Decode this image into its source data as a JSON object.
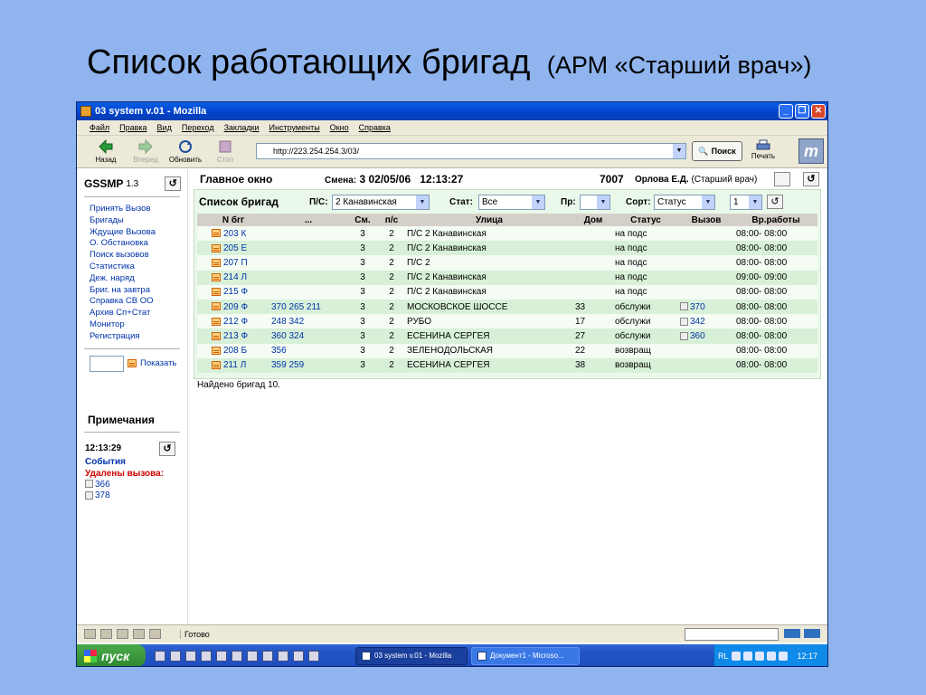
{
  "slide": {
    "title": "Список работающих бригад",
    "subtitle": "(АРМ «Старший врач»)"
  },
  "window": {
    "title": "03 system v.01 - Mozilla",
    "menu": [
      "Файл",
      "Правка",
      "Вид",
      "Переход",
      "Закладки",
      "Инструменты",
      "Окно",
      "Справка"
    ],
    "toolbar": {
      "back": "Назад",
      "forward": "Вперед",
      "reload": "Обновить",
      "stop": "Стоп",
      "url": "http://223.254.254.3/03/",
      "search": "Поиск",
      "print": "Печать"
    },
    "logo_letter": "m"
  },
  "sidebar": {
    "app_name": "GSSMP",
    "version": "1.3",
    "links": [
      "Принять Вызов",
      "Бригады",
      "Ждущие Вызова",
      "О. Обстановка",
      "Поиск вызовов",
      "Статистика",
      "Деж. наряд",
      "Бриг. на завтра",
      "Справка СВ ОО",
      "Архив Сп+Стат",
      "Монитор",
      "Регистрация"
    ],
    "show_label": "Показать",
    "notes_title": "Примечания",
    "notes_time": "12:13:29",
    "events_label": "События",
    "deleted_label": "Удалены вызова:",
    "deleted_calls": [
      "366",
      "378"
    ]
  },
  "main": {
    "title": "Главное окно",
    "shift_label": "Смена:",
    "shift_no": "3",
    "date": "02/05/06",
    "time": "12:13:27",
    "user_id": "7007",
    "user_name": "Орлова Е.Д.",
    "user_role": "(Старший врач)"
  },
  "brigades": {
    "title": "Список бригад",
    "ps_label": "П/С:",
    "ps_value": "2 Канавинская",
    "stat_label": "Стат:",
    "stat_value": "Все",
    "pr_label": "Пр:",
    "pr_value": "",
    "sort_label": "Сорт:",
    "sort_value": "Статус",
    "page_value": "1",
    "columns": [
      "N бrг",
      "...",
      "См.",
      "п/с",
      "Улица",
      "Дом",
      "Статус",
      "Вызов",
      "Вр.работы"
    ],
    "rows": [
      {
        "brig": "203 К",
        "calls": "",
        "shift": "3",
        "ps": "2",
        "street": "П/С 2 Канавинская",
        "house": "",
        "status": "на подс",
        "call": "",
        "hours": "08:00- 08:00"
      },
      {
        "brig": "205 Е",
        "calls": "",
        "shift": "3",
        "ps": "2",
        "street": "П/С 2 Канавинская",
        "house": "",
        "status": "на подс",
        "call": "",
        "hours": "08:00- 08:00"
      },
      {
        "brig": "207 П",
        "calls": "",
        "shift": "3",
        "ps": "2",
        "street": "П/С 2",
        "house": "",
        "status": "на подс",
        "call": "",
        "hours": "08:00- 08:00"
      },
      {
        "brig": "214 Л",
        "calls": "",
        "shift": "3",
        "ps": "2",
        "street": "П/С 2 Канавинская",
        "house": "",
        "status": "на подс",
        "call": "",
        "hours": "09:00- 09:00"
      },
      {
        "brig": "215 Ф",
        "calls": "",
        "shift": "3",
        "ps": "2",
        "street": "П/С 2 Канавинская",
        "house": "",
        "status": "на подс",
        "call": "",
        "hours": "08:00- 08:00"
      },
      {
        "brig": "209 Ф",
        "calls": "370 265 211",
        "shift": "3",
        "ps": "2",
        "street": "МОСКОВСКОЕ ШОССЕ",
        "house": "33",
        "status": "обслужи",
        "call": "370",
        "hours": "08:00- 08:00"
      },
      {
        "brig": "212 Ф",
        "calls": "248 342",
        "shift": "3",
        "ps": "2",
        "street": "РУБО",
        "house": "17",
        "status": "обслужи",
        "call": "342",
        "hours": "08:00- 08:00"
      },
      {
        "brig": "213 Ф",
        "calls": "360 324",
        "shift": "3",
        "ps": "2",
        "street": "ЕСЕНИНА СЕРГЕЯ",
        "house": "27",
        "status": "обслужи",
        "call": "360",
        "hours": "08:00- 08:00"
      },
      {
        "brig": "208 Б",
        "calls": "356",
        "shift": "3",
        "ps": "2",
        "street": "ЗЕЛЕНОДОЛЬСКАЯ",
        "house": "22",
        "status": "возвращ",
        "call": "",
        "hours": "08:00- 08:00"
      },
      {
        "brig": "211 Л",
        "calls": "359 259",
        "shift": "3",
        "ps": "2",
        "street": "ЕСЕНИНА СЕРГЕЯ",
        "house": "38",
        "status": "возвращ",
        "call": "",
        "hours": "08:00- 08:00"
      }
    ],
    "found": "Найдено бригад 10."
  },
  "statusbar": {
    "text": "Готово"
  },
  "taskbar": {
    "start": "пуск",
    "tasks": [
      "03 system v.01 - Mozilla",
      "Документ1 - Microso..."
    ],
    "lang": "RL",
    "clock": "12:17"
  }
}
